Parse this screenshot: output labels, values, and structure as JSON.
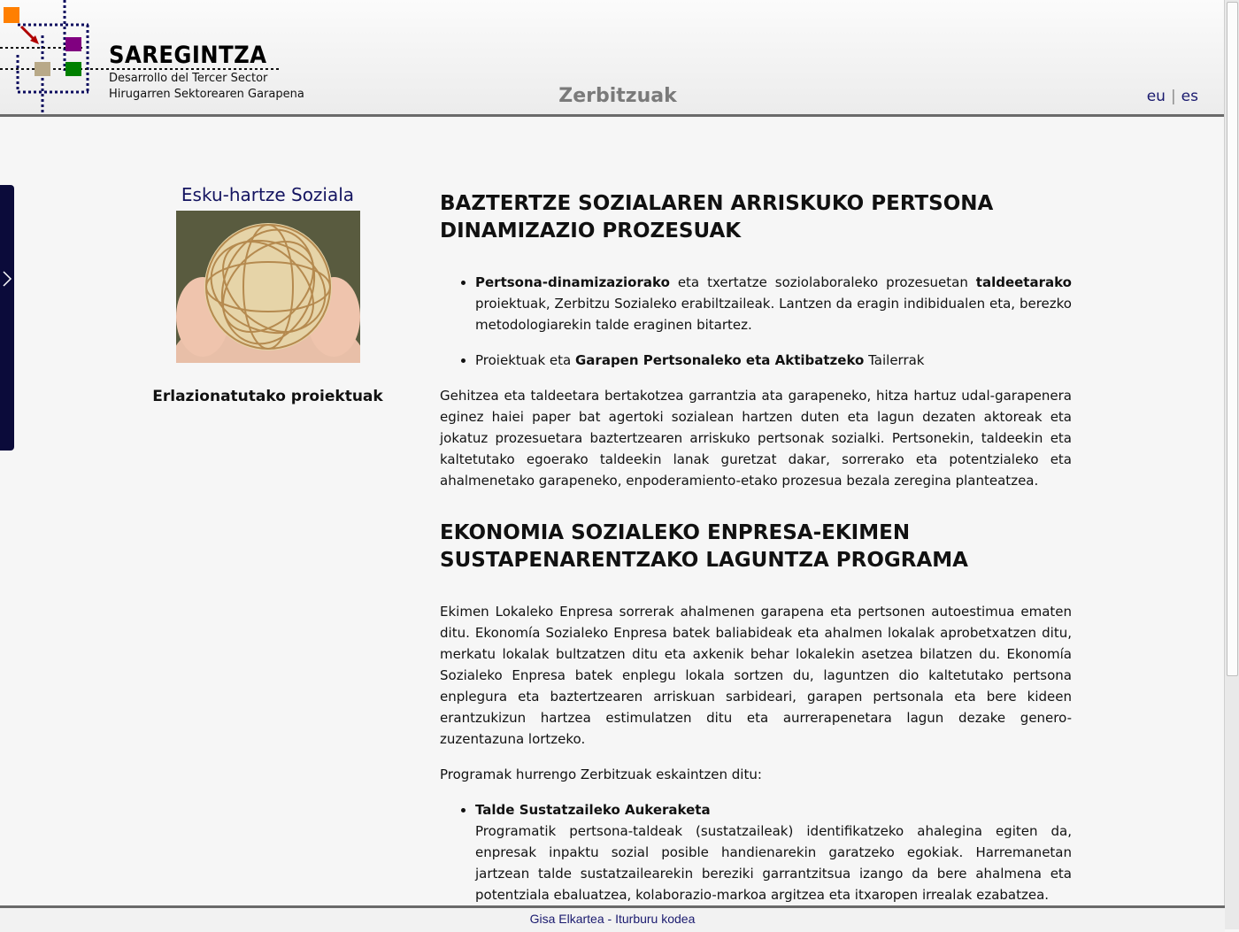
{
  "header": {
    "brand_title": "SAREGINTZA",
    "brand_sub1": "Desarrollo del Tercer Sector",
    "brand_sub2": "Hirugarren Sektorearen Garapena",
    "page_heading": "Zerbitzuak",
    "lang_eu": "eu",
    "lang_es": "es"
  },
  "sidebar": {
    "title": "Esku-hartze Soziala",
    "related": "Erlazionatutako proiektuak"
  },
  "main": {
    "section1": {
      "title": "BAZTERTZE SOZIALAREN ARRISKUKO PERTSONA DINAMIZAZIO PROZESUAK",
      "b1_bold1": "Pertsona-dinamizaziorako",
      "b1_text1": " eta txertatze soziolaboraleko prozesuetan ",
      "b1_bold2": "taldeetarako",
      "b1_text2": " proiektuak, Zerbitzu Sozialeko erabiltzaileak. Lantzen da eragin indibidualen eta, berezko metodologiarekin talde eraginen bitartez.",
      "b2_text1": "Proiektuak eta ",
      "b2_bold": "Garapen Pertsonaleko eta Aktibatzeko",
      "b2_text2": " Tailerrak",
      "para": "Gehitzea eta taldeetara bertakotzea garrantzia ata garapeneko, hitza hartuz udal-garapenera eginez haiei paper bat agertoki sozialean hartzen duten eta lagun dezaten aktoreak eta jokatuz prozesuetara baztertzearen arriskuko pertsonak sozialki. Pertsonekin, taldeekin eta kaltetutako egoerako taldeekin lanak guretzat dakar, sorrerako eta potentzialeko eta ahalmenetako garapeneko, enpoderamiento-etako prozesua bezala zeregina planteatzea."
    },
    "section2": {
      "title": "EKONOMIA SOZIALEKO ENPRESA-EKIMEN SUSTAPENARENTZAKO LAGUNTZA PROGRAMA",
      "para1": "Ekimen Lokaleko Enpresa sorrerak ahalmenen garapena eta pertsonen autoestimua ematen ditu. Ekonomía Sozialeko Enpresa batek baliabideak eta ahalmen lokalak aprobetxatzen ditu, merkatu lokalak bultzatzen ditu eta axkenik behar lokalekin asetzea bilatzen du. Ekonomía Sozialeko Enpresa batek enplegu lokala sortzen du, laguntzen dio kaltetutako pertsona enplegura eta baztertzearen arriskuan sarbideari, garapen pertsonala eta bere kideen erantzukizun hartzea estimulatzen ditu eta aurrerapenetara lagun dezake genero-zuzentazuna lortzeko.",
      "para2": "Programak hurrengo Zerbitzuak eskaintzen ditu:",
      "b1_title": "Talde Sustatzaileko Aukeraketa",
      "b1_text": "Programatik pertsona-taldeak (sustatzaileak) identifikatzeko ahalegina egiten da, enpresak inpaktu sozial posible handienarekin garatzeko egokiak. Harremanetan jartzean talde sustatzailearekin bereziki garrantzitsua izango da bere ahalmena eta potentziala ebaluatzea, kolaborazio-markoa argitzea eta itxaropen irrealak ezabatzea."
    }
  },
  "footer": {
    "link1": "Gisa Elkartea",
    "sep": " - ",
    "link2": "Iturburu kodea"
  },
  "colors": {
    "logo_orange": "#ff7f00",
    "logo_purple": "#800080",
    "logo_green": "#008000",
    "logo_tan": "#b8a988",
    "logo_navy": "#0b0b5e",
    "arrow_red": "#b00000"
  }
}
